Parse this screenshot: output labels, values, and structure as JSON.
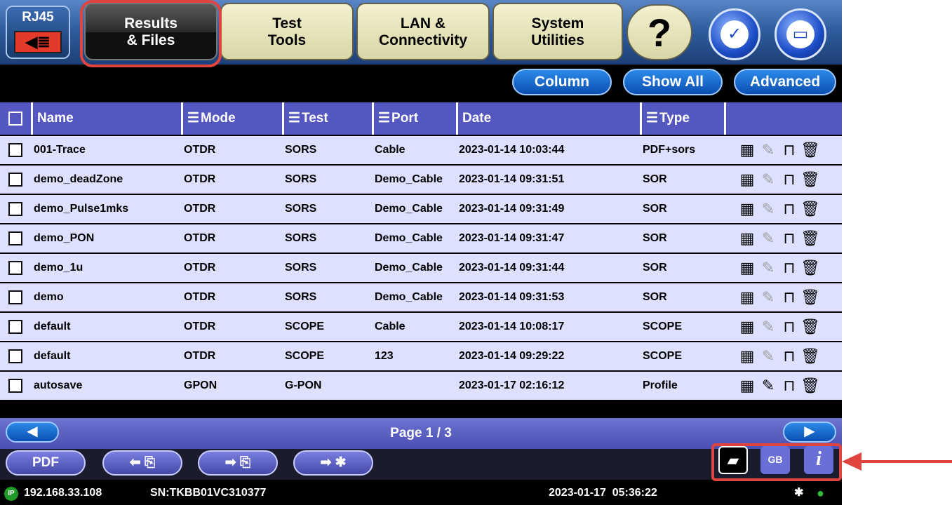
{
  "topbar": {
    "rj45": {
      "label": "RJ45",
      "port_icon": "plug-arrow-icon"
    },
    "tabs": [
      {
        "label": "Results\n& Files",
        "active": true
      },
      {
        "label": "Test\nTools",
        "active": false
      },
      {
        "label": "LAN &\nConnectivity",
        "active": false
      },
      {
        "label": "System\nUtilities",
        "active": false
      }
    ],
    "help_label": "?",
    "round_icons": [
      "network-settings-icon",
      "folder-icon"
    ]
  },
  "actions": {
    "column": "Column",
    "show_all": "Show All",
    "advanced": "Advanced"
  },
  "table": {
    "headers": {
      "name": "Name",
      "mode": "Mode",
      "test": "Test",
      "port": "Port",
      "date": "Date",
      "type": "Type"
    },
    "rows": [
      {
        "name": "001-Trace",
        "mode": "OTDR",
        "test": "SORS",
        "port": "Cable",
        "date": "2023-01-14 10:03:44",
        "type": "PDF+sors"
      },
      {
        "name": "demo_deadZone",
        "mode": "OTDR",
        "test": "SORS",
        "port": "Demo_Cable",
        "date": "2023-01-14 09:31:51",
        "type": "SOR"
      },
      {
        "name": "demo_Pulse1mks",
        "mode": "OTDR",
        "test": "SORS",
        "port": "Demo_Cable",
        "date": "2023-01-14 09:31:49",
        "type": "SOR"
      },
      {
        "name": "demo_PON",
        "mode": "OTDR",
        "test": "SORS",
        "port": "Demo_Cable",
        "date": "2023-01-14 09:31:47",
        "type": "SOR"
      },
      {
        "name": "demo_1u",
        "mode": "OTDR",
        "test": "SORS",
        "port": "Demo_Cable",
        "date": "2023-01-14 09:31:44",
        "type": "SOR"
      },
      {
        "name": "demo",
        "mode": "OTDR",
        "test": "SORS",
        "port": "Demo_Cable",
        "date": "2023-01-14 09:31:53",
        "type": "SOR"
      },
      {
        "name": "default",
        "mode": "OTDR",
        "test": "SCOPE",
        "port": "Cable",
        "date": "2023-01-14 10:08:17",
        "type": "SCOPE"
      },
      {
        "name": "default",
        "mode": "OTDR",
        "test": "SCOPE",
        "port": "123",
        "date": "2023-01-14 09:29:22",
        "type": "SCOPE"
      },
      {
        "name": "autosave",
        "mode": "GPON",
        "test": "G-PON",
        "port": "",
        "date": "2023-01-17 02:16:12",
        "type": "Profile"
      }
    ]
  },
  "pager": {
    "label": "Page 1 / 3",
    "prev_icon": "left-arrow-icon",
    "next_icon": "right-arrow-icon"
  },
  "toolbar": {
    "pdf": "PDF",
    "gb_label": "GB",
    "info_label": "i"
  },
  "status": {
    "ip": "192.168.33.108",
    "ip_badge": "IP",
    "sn": "SN:TKBB01VC310377",
    "datetime": "2023-01-17  05:36:22"
  },
  "colors": {
    "accent": "#0b4fb1",
    "header": "#5357bf",
    "row": "#dde0ff",
    "highlight": "#e0443e"
  }
}
